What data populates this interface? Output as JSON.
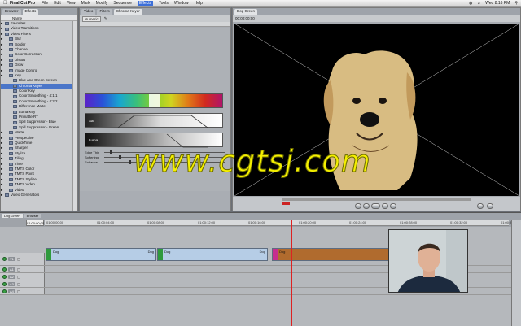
{
  "menubar": {
    "app": "Final Cut Pro",
    "items": [
      "File",
      "Edit",
      "View",
      "Mark",
      "Modify",
      "Sequence",
      "Effects",
      "Tools",
      "Window",
      "Help"
    ],
    "active": "Effects",
    "clock": "Wed 8:16 PM"
  },
  "effects_panel": {
    "tabs": [
      "Browser",
      "Effects"
    ],
    "column_header": "Name",
    "items": [
      {
        "label": "Favorites",
        "level": 0
      },
      {
        "label": "Video Transitions",
        "level": 0
      },
      {
        "label": "Video Filters",
        "level": 0
      },
      {
        "label": "Blur",
        "level": 1
      },
      {
        "label": "Border",
        "level": 1
      },
      {
        "label": "Channel",
        "level": 1
      },
      {
        "label": "Color Correction",
        "level": 1
      },
      {
        "label": "Distort",
        "level": 1
      },
      {
        "label": "Glow",
        "level": 1
      },
      {
        "label": "Image Control",
        "level": 1
      },
      {
        "label": "Key",
        "level": 1
      },
      {
        "label": "Blue and Green Screen",
        "level": 2
      },
      {
        "label": "Chroma Keyer",
        "level": 2,
        "selected": true
      },
      {
        "label": "Color Key",
        "level": 2
      },
      {
        "label": "Color Smoothing - 4:1:1",
        "level": 2
      },
      {
        "label": "Color Smoothing - 4:2:2",
        "level": 2
      },
      {
        "label": "Difference Matte",
        "level": 2
      },
      {
        "label": "Luma Key",
        "level": 2
      },
      {
        "label": "Primatte RT",
        "level": 2
      },
      {
        "label": "Spill Suppressor - Blue",
        "level": 2
      },
      {
        "label": "Spill Suppressor - Green",
        "level": 2
      },
      {
        "label": "Matte",
        "level": 1
      },
      {
        "label": "Perspective",
        "level": 1
      },
      {
        "label": "QuickTime",
        "level": 1
      },
      {
        "label": "Sharpen",
        "level": 1
      },
      {
        "label": "Stylize",
        "level": 1
      },
      {
        "label": "Tiling",
        "level": 1
      },
      {
        "label": "Time",
        "level": 1
      },
      {
        "label": "TMTS Color",
        "level": 1
      },
      {
        "label": "TMTS Point",
        "level": 1
      },
      {
        "label": "TMTS Stylize",
        "level": 1
      },
      {
        "label": "TMTS Video",
        "level": 1
      },
      {
        "label": "Video",
        "level": 1
      },
      {
        "label": "Video Generators",
        "level": 0
      }
    ]
  },
  "viewer": {
    "tabs": [
      "Video",
      "Filters",
      "Chroma Keyer"
    ],
    "toolbar_label": "Numeric",
    "sat_label": "Sat",
    "luma_label": "Luma",
    "sliders": [
      {
        "label": "Edge Thin",
        "value": 0.05
      },
      {
        "label": "Softening",
        "value": 0.12
      },
      {
        "label": "Enhance",
        "value": 0.2
      }
    ]
  },
  "canvas": {
    "tab": "Dog Green",
    "timecode": "00:00:00;00"
  },
  "timeline": {
    "tabs": [
      "Dog Green",
      "Browser"
    ],
    "timecode": "01:00:00;00",
    "ruler_ticks": [
      "01:00:00;00",
      "01:00:04;00",
      "01:00:08;00",
      "01:00:12;00",
      "01:00:16;00",
      "01:00:20;00",
      "01:00:24;00",
      "01:00:28;00",
      "01:00:32;00",
      "01:00:36;00"
    ],
    "tracks": [
      {
        "label": "V1"
      },
      {
        "label": "A1"
      },
      {
        "label": "A2"
      },
      {
        "label": "A3"
      },
      {
        "label": "A4"
      }
    ],
    "clips": [
      {
        "name": "Dog",
        "end_name": "Dog",
        "color": "#b6cde6",
        "kind": "normal"
      },
      {
        "name": "Dog",
        "end_name": "Dog",
        "color": "#b6cde6",
        "kind": "normal"
      },
      {
        "name": "Dog",
        "end_name": "",
        "color": "#b06b2e",
        "kind": "orange"
      }
    ]
  },
  "watermark": {
    "text": "www.cgtsj.com"
  },
  "colors": {
    "accent": "#4b76c9",
    "watermark": "#f5f000"
  }
}
